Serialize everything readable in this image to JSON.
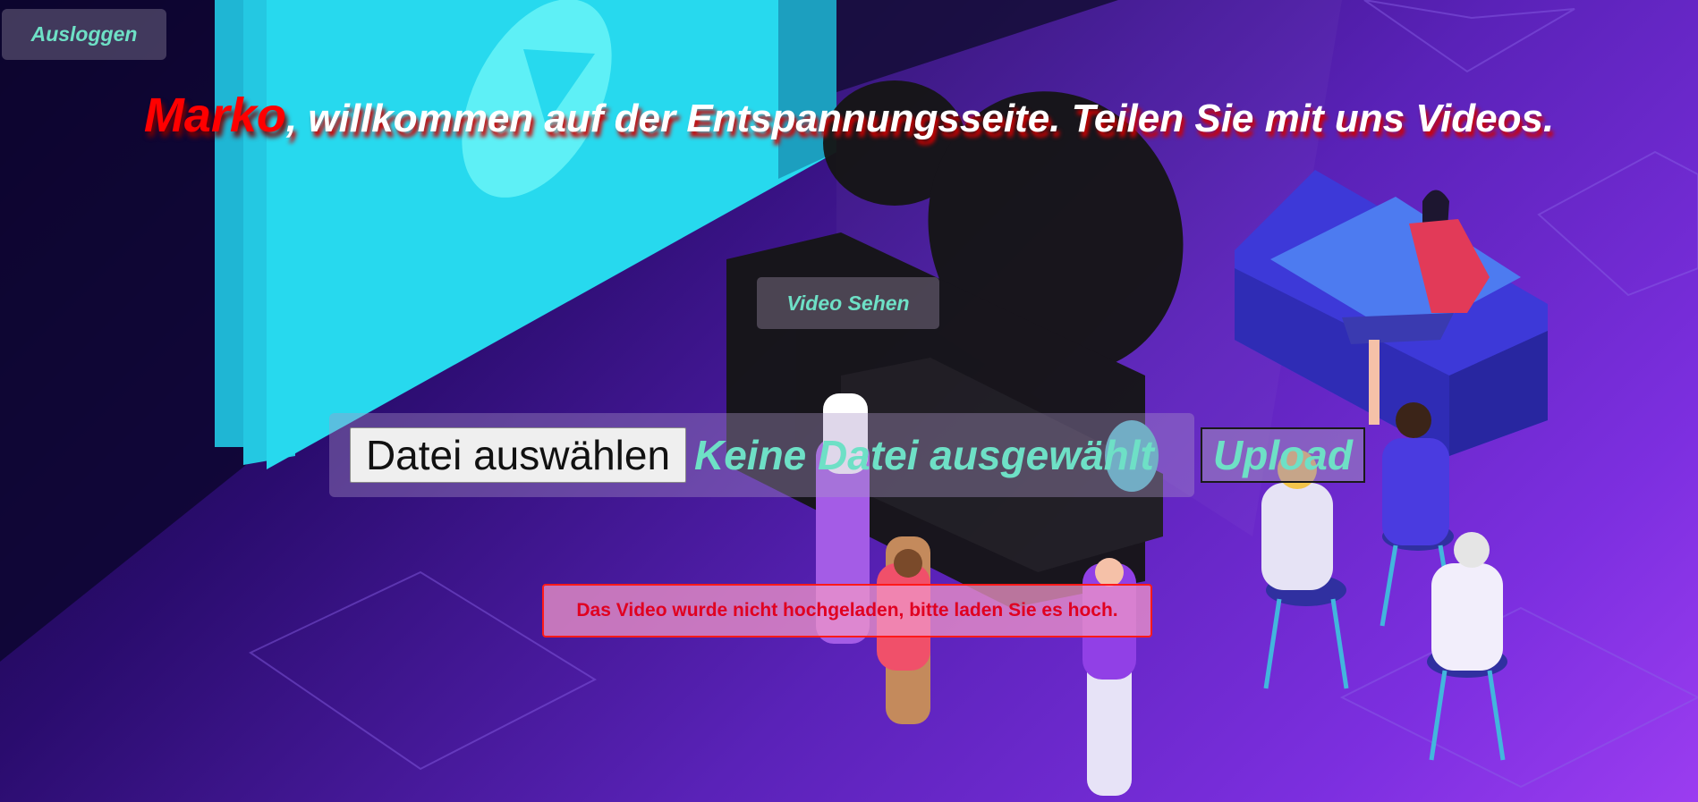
{
  "header": {
    "logout_label": "Ausloggen",
    "user_name": "Marko",
    "welcome_text": ", willkommen auf der Entspannungsseite. Teilen Sie mit uns Videos."
  },
  "main": {
    "watch_video_label": "Video Sehen",
    "file_input": {
      "button_label": "Datei auswählen",
      "status_text": "Keine Datei ausgewählt"
    },
    "upload_label": "Upload",
    "error_message": "Das Video wurde nicht hochgeladen, bitte laden Sie es hoch."
  },
  "colors": {
    "accent_text": "#6ee0c6",
    "error": "#e00020",
    "username": "#ff0000"
  }
}
